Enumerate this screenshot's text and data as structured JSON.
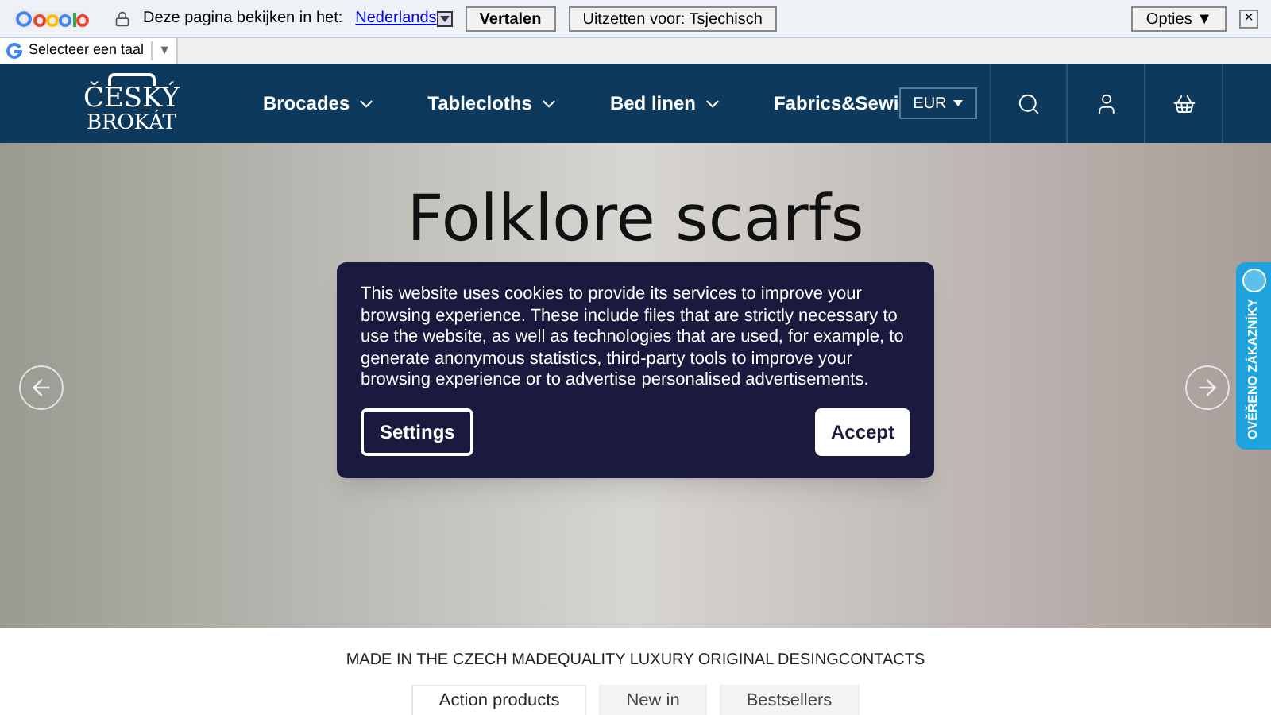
{
  "translate_bar": {
    "prompt": "Deze pagina bekijken in het:",
    "language": "Nederlands",
    "translate_button": "Vertalen",
    "disable_button": "Uitzetten voor: Tsjechisch",
    "options_button": "Opties ▼",
    "close": "×"
  },
  "language_select": {
    "label": "Selecteer een taal",
    "caret": "▼"
  },
  "nav": {
    "logo_top": "ČESKÝ",
    "logo_bottom": "BROKÁT",
    "items": [
      {
        "label": "Brocades",
        "dropdown": true
      },
      {
        "label": "Tablecloths",
        "dropdown": true
      },
      {
        "label": "Bed linen",
        "dropdown": true
      },
      {
        "label": "Fabrics&Sewi",
        "dropdown": false
      }
    ],
    "currency": "EUR"
  },
  "hero": {
    "title": "Folklore scarfs"
  },
  "cookie_dialog": {
    "text": "This website uses cookies to provide its services to improve your browsing experience. These include files that are strictly necessary to use the website, as well as technologies that are used, for example, to generate anonymous statistics, third-party tools to improve your browsing experience or to advertise personalised advertisements.",
    "settings": "Settings",
    "accept": "Accept"
  },
  "badge": {
    "text": "OVĚŘENO ZÁKAZNÍKY"
  },
  "tagline": "MADE IN THE CZECH MADEQUALITY LUXURY ORIGINAL DESINGCONTACTS",
  "product_tabs": [
    {
      "label": "Action products",
      "selected": true
    },
    {
      "label": "New in",
      "selected": false
    },
    {
      "label": "Bestsellers",
      "selected": false
    }
  ]
}
